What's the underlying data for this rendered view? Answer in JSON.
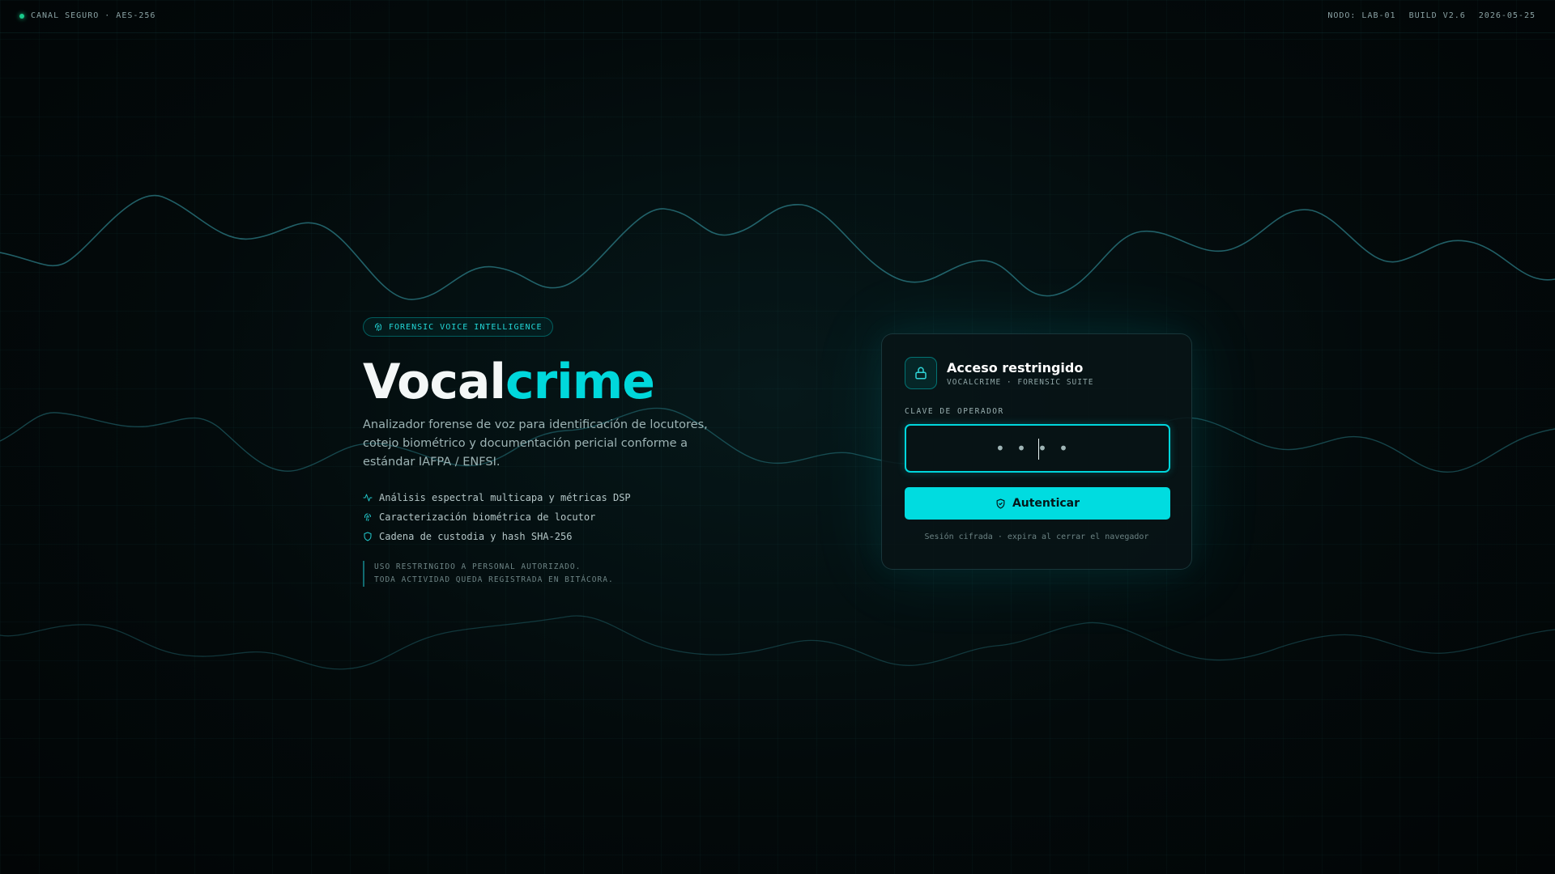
{
  "topbar": {
    "status_text": "CANAL SEGURO · AES-256",
    "node": "NODO: LAB-01",
    "build": "BUILD V2.6",
    "date": "2026-05-25"
  },
  "hero": {
    "badge": "FORENSIC VOICE INTELLIGENCE",
    "title_primary": "Vocal",
    "title_accent": "crime",
    "description": "Analizador forense de voz para identificación de locutores, cotejo biométrico y documentación pericial conforme a estándar IAFPA / ENFSI.",
    "features": [
      {
        "icon": "waveform-icon",
        "label": "Análisis espectral multicapa y métricas DSP"
      },
      {
        "icon": "fingerprint-icon",
        "label": "Caracterización biométrica de locutor"
      },
      {
        "icon": "shield-icon",
        "label": "Cadena de custodia y hash SHA-256"
      }
    ],
    "notice_line1": "USO RESTRINGIDO A PERSONAL AUTORIZADO.",
    "notice_line2": "TODA ACTIVIDAD QUEDA REGISTRADA EN BITÁCORA."
  },
  "login": {
    "title": "Acceso restringido",
    "subtitle": "VOCALCRIME · FORENSIC SUITE",
    "field_label": "CLAVE DE OPERADOR",
    "password_mask": "••••",
    "button_label": "Autenticar",
    "session_note": "Sesión cifrada · expira al cerrar el navegador"
  },
  "colors": {
    "accent": "#00d8dc",
    "status": "#19c98a",
    "background": "#030a0b"
  }
}
